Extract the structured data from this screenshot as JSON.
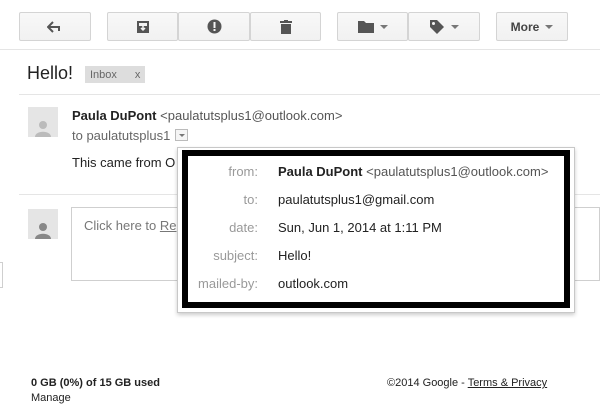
{
  "toolbar": {
    "more_label": "More",
    "icons": [
      "back-arrow-icon",
      "archive-icon",
      "report-spam-icon",
      "delete-icon",
      "folder-icon",
      "tag-icon"
    ]
  },
  "message": {
    "subject": "Hello!",
    "label": "Inbox",
    "label_close": "x",
    "sender_name": "Paula DuPont",
    "sender_email": "<paulatutsplus1@outlook.com>",
    "to_line": "to paulatutsplus1",
    "body_preview": "This came from O"
  },
  "reply": {
    "prefix": "Click here to ",
    "link": "Re"
  },
  "details_popup": {
    "rows": [
      {
        "label": "from:",
        "name": "Paula DuPont",
        "value": "<paulatutsplus1@outlook.com>"
      },
      {
        "label": "to:",
        "value": "paulatutsplus1@gmail.com"
      },
      {
        "label": "date:",
        "value": "Sun, Jun 1, 2014 at 1:11 PM"
      },
      {
        "label": "subject:",
        "value": "Hello!"
      },
      {
        "label": "mailed-by:",
        "value": "outlook.com"
      }
    ]
  },
  "footer": {
    "storage": "0 GB (0%) of 15 GB used",
    "manage": "Manage",
    "copyright": "©2014 Google - ",
    "terms": "Terms & Privacy"
  }
}
